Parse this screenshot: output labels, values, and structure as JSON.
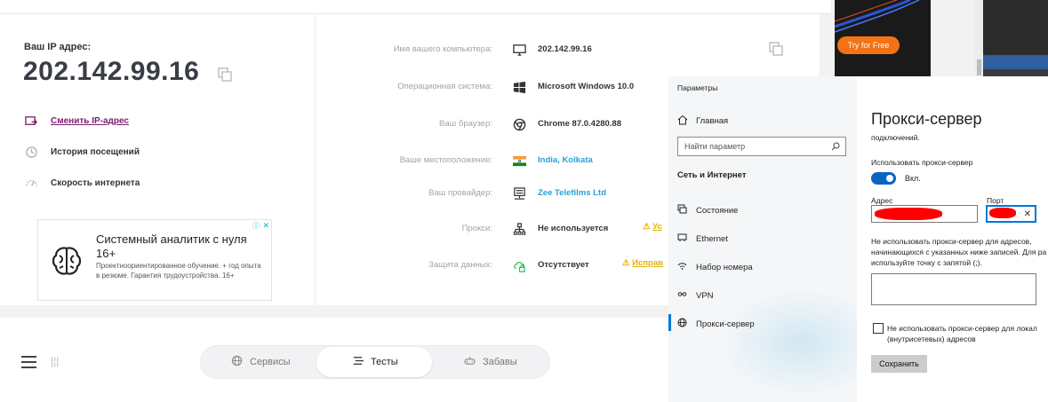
{
  "site": {
    "ip_label": "Ваш IP адрес:",
    "ip_value": "202.142.99.16",
    "links": [
      {
        "label": "Сменить IP-адрес",
        "icon": "change-ip-icon"
      },
      {
        "label": "История посещений",
        "icon": "history-icon"
      },
      {
        "label": "Скорость интернета",
        "icon": "speed-icon"
      }
    ],
    "info_rows": [
      {
        "label": "Имя вашего компьютера:",
        "value": "202.142.99.16",
        "icon": "monitor-icon"
      },
      {
        "label": "Операционная система:",
        "value": "Microsoft Windows 10.0",
        "icon": "windows-icon"
      },
      {
        "label": "Ваш браузер:",
        "value": "Chrome 87.0.4280.88",
        "icon": "chrome-icon"
      },
      {
        "label": "Ваше местоположение:",
        "value": "India, Kolkata",
        "icon": "india-flag-icon"
      },
      {
        "label": "Ваш провайдер:",
        "value": "Zee Telefilms Ltd",
        "icon": "provider-icon"
      },
      {
        "label": "Прокси:",
        "value": "Не используется",
        "icon": "proxy-icon",
        "warning": "Ус"
      },
      {
        "label": "Защита данных:",
        "value": "Отсутствует",
        "icon": "cloud-lock-icon",
        "warning": "Исправ"
      }
    ],
    "ad": {
      "title": "Системный аналитик с нуля 16+",
      "text": "Проектноориентированное обучение. + год опыта в резюме. Гарантия трудоустройства. 16+",
      "close": "✕"
    },
    "top_ad": {
      "button": "Try for Free"
    },
    "tabs": [
      {
        "label": "Сервисы",
        "icon": "globe-icon"
      },
      {
        "label": "Тесты",
        "icon": "list-icon"
      },
      {
        "label": "Забавы",
        "icon": "gamepad-icon"
      }
    ],
    "colors": {
      "link": "#7b1e6e",
      "accent": "#2a9fd6",
      "warning": "#e3b200"
    }
  },
  "settings": {
    "window_title": "Параметры",
    "home": "Главная",
    "search_placeholder": "Найти параметр",
    "section": "Сеть и Интернет",
    "nav": [
      {
        "label": "Состояние",
        "icon": "status-icon"
      },
      {
        "label": "Ethernet",
        "icon": "ethernet-icon"
      },
      {
        "label": "Набор номера",
        "icon": "dialup-icon"
      },
      {
        "label": "VPN",
        "icon": "vpn-icon"
      },
      {
        "label": "Прокси-сервер",
        "icon": "proxy-globe-icon"
      }
    ],
    "title": "Прокси-сервер",
    "cut_line": "подключений.",
    "use_proxy_label": "Использовать прокси-сервер",
    "toggle_state": "Вкл.",
    "address_label": "Адрес",
    "port_label": "Порт",
    "exceptions_text": "Не использовать прокси-сервер для адресов, начинающихся с указанных ниже записей. Для ра используйте точку с запятой (;).",
    "local_checkbox_text": "Не использовать прокси-сервер для локал (внутрисетевых) адресов",
    "save_button": "Сохранить",
    "colors": {
      "toggle": "#0a64c2",
      "nav_active": "#0078d7"
    }
  }
}
